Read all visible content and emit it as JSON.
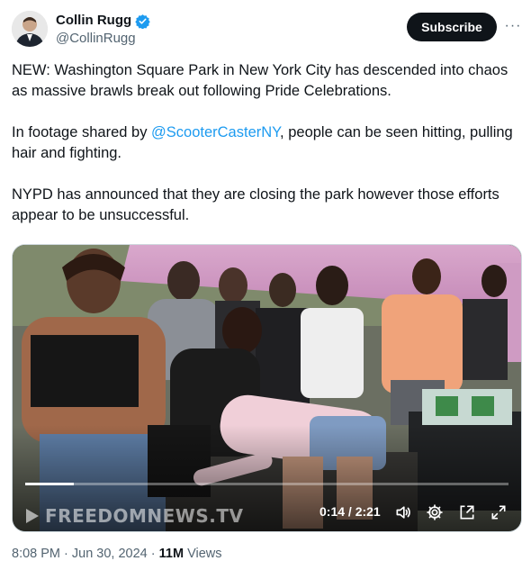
{
  "author": {
    "display_name": "Collin Rugg",
    "handle": "@CollinRugg",
    "verified_icon": "verified-badge-icon"
  },
  "subscribe_label": "Subscribe",
  "more_label": "···",
  "text": {
    "p1": "NEW: Washington Square Park in New York City has descended into chaos as massive brawls break out following Pride Celebrations.",
    "p2_before": "In footage shared by ",
    "p2_mention": "@ScooterCasterNY",
    "p2_after": ", people can be seen hitting, pulling hair and fighting.",
    "p3": "NYPD has announced that they are closing the park however those efforts appear to be unsuccessful."
  },
  "video": {
    "watermark": "FREEDOMNEWS.TV",
    "time": "0:14 / 2:21",
    "progress": 0.1,
    "controls": [
      "volume-icon",
      "settings-gear-icon",
      "picture-in-picture-icon",
      "fullscreen-icon"
    ]
  },
  "meta": {
    "timestamp": "8:08 PM · Jun 30, 2024 · ",
    "views_count": "11M",
    "views_label": " Views"
  },
  "colors": {
    "link": "#1d9bf0",
    "verified": "#1d9bf0",
    "button_bg": "#0f1419",
    "secondary_text": "#536471"
  }
}
